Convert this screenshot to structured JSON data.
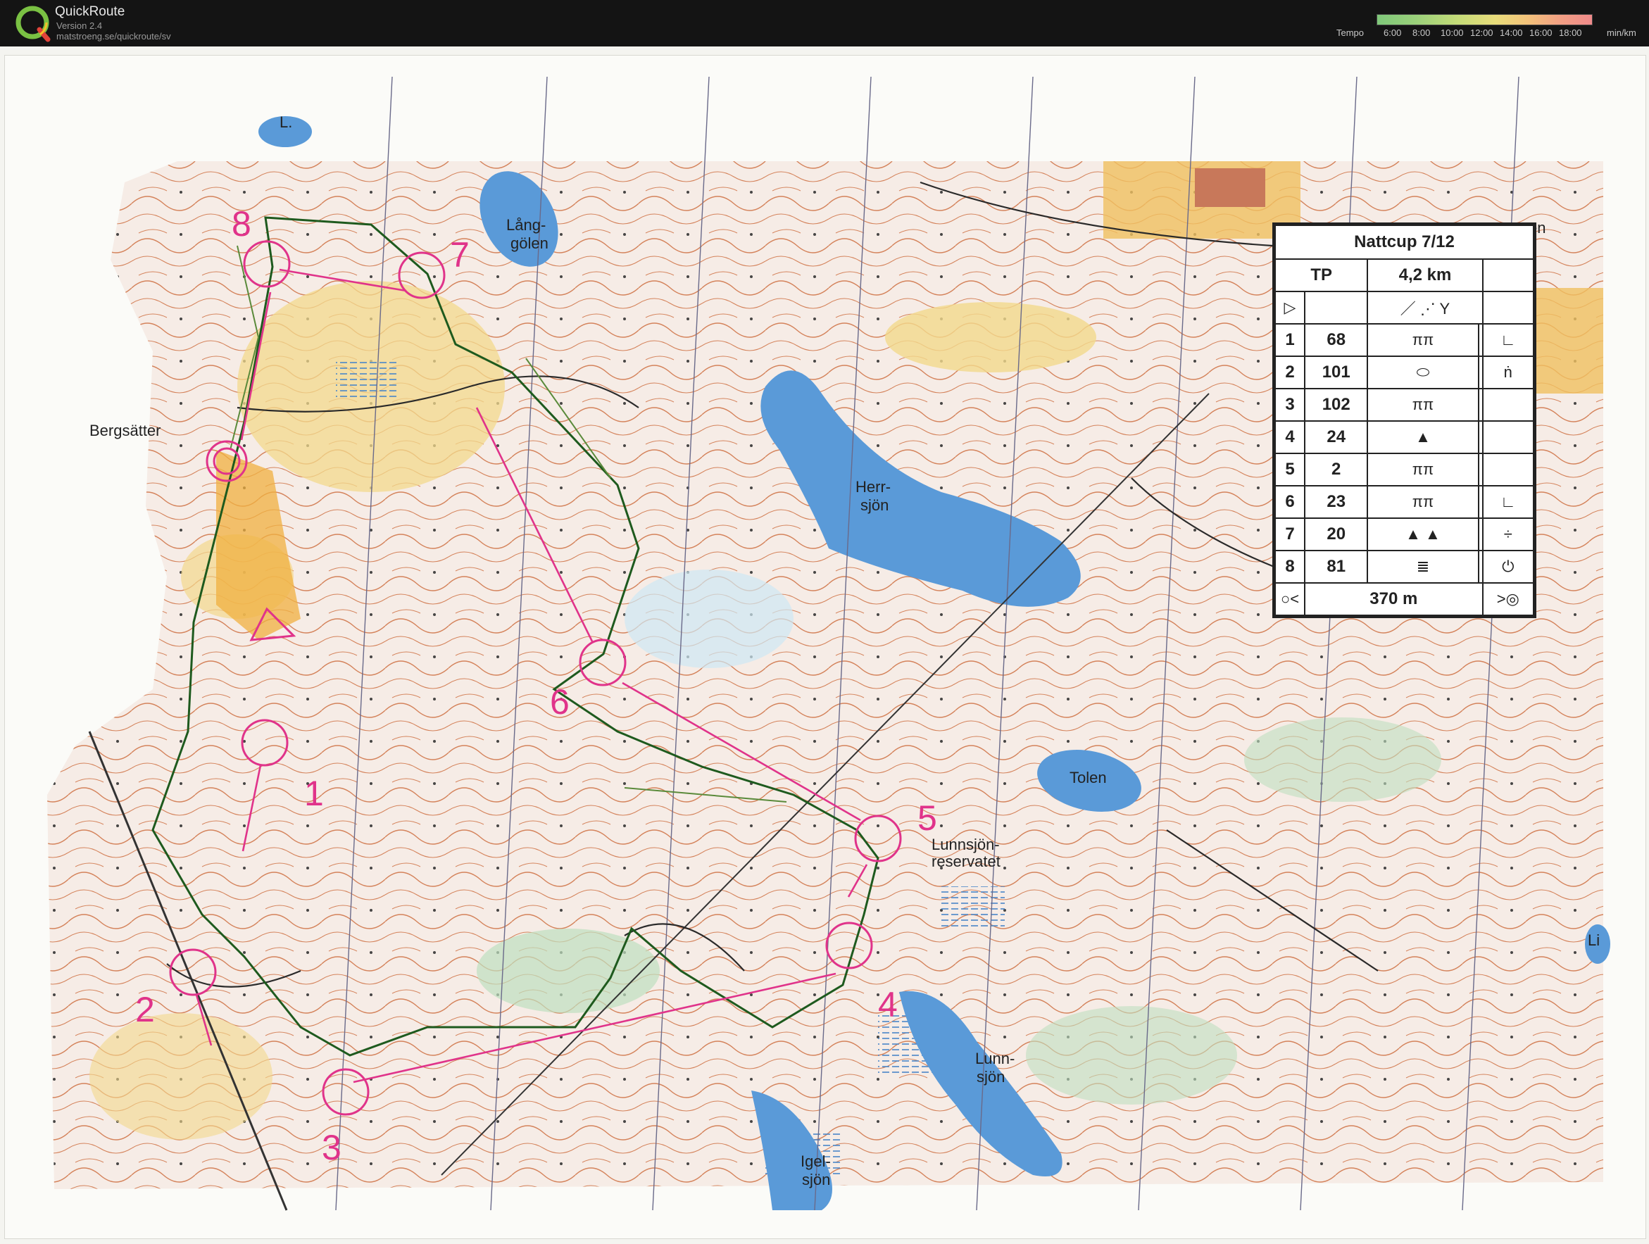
{
  "app": {
    "name": "QuickRoute",
    "version": "Version 2.4",
    "url": "matstroeng.se/quickroute/sv",
    "tempo_label": "Tempo",
    "tempo_ticks": [
      "6:00",
      "8:00",
      "10:00",
      "12:00",
      "14:00",
      "16:00",
      "18:00"
    ],
    "tempo_unit": "min/km",
    "colors": {
      "route_line": "#1e5a1e",
      "course_line": "#e0338a",
      "contour": "#c85a2a",
      "water": "#5a9ad8"
    }
  },
  "map": {
    "place_names": [
      "Bergsätter",
      "Lång-",
      "gölen",
      "Herr-",
      "sjön",
      "Tolen",
      "Lunnsjön-",
      "reservatet",
      "Lunn-",
      "sjön",
      "Igel-",
      "sjön",
      "L.",
      "en",
      "Li"
    ],
    "controls": [
      "1",
      "2",
      "3",
      "4",
      "5",
      "6",
      "7",
      "8"
    ]
  },
  "legend": {
    "title": "Nattcup 7/12",
    "class": "TP",
    "distance": "4,2 km",
    "rows": [
      {
        "n": "1",
        "code": "68"
      },
      {
        "n": "2",
        "code": "101"
      },
      {
        "n": "3",
        "code": "102"
      },
      {
        "n": "4",
        "code": "24"
      },
      {
        "n": "5",
        "code": "2"
      },
      {
        "n": "6",
        "code": "23"
      },
      {
        "n": "7",
        "code": "20"
      },
      {
        "n": "8",
        "code": "81"
      }
    ],
    "finish": "370 m"
  }
}
